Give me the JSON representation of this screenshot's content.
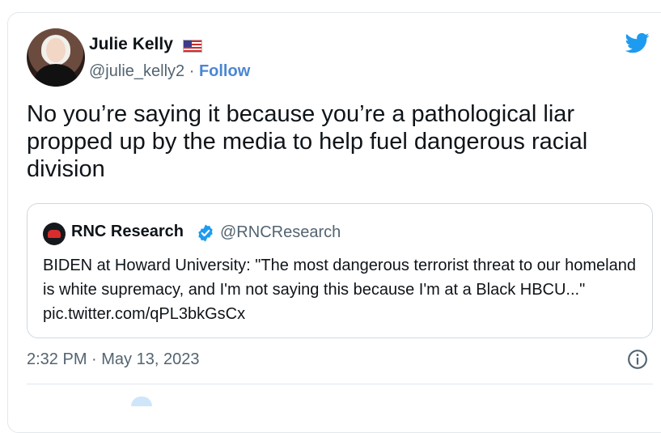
{
  "author": {
    "name": "Julie Kelly",
    "handle": "@julie_kelly2",
    "separator": "·",
    "follow_label": "Follow"
  },
  "tweet": {
    "text": "No you’re saying it because you’re a pathological liar propped up by the media to help fuel dangerous racial division",
    "timestamp": "2:32 PM · May 13, 2023"
  },
  "quoted": {
    "name": "RNC Research",
    "handle": "@RNCResearch",
    "text": "BIDEN at Howard University: \"The most dangerous terrorist threat to our homeland is white supremacy, and I'm not saying this because I'm at a Black HBCU...\" pic.twitter.com/qPL3bkGsCx"
  },
  "icons": {
    "brand": "twitter-bird-icon",
    "verified": "verified-badge-icon",
    "info": "info-icon",
    "flag": "us-flag-icon"
  },
  "colors": {
    "brand_blue": "#1d9bf0",
    "link_blue": "#4a86d4",
    "text": "#0f1419",
    "muted": "#536471",
    "border": "#cfd9de"
  }
}
